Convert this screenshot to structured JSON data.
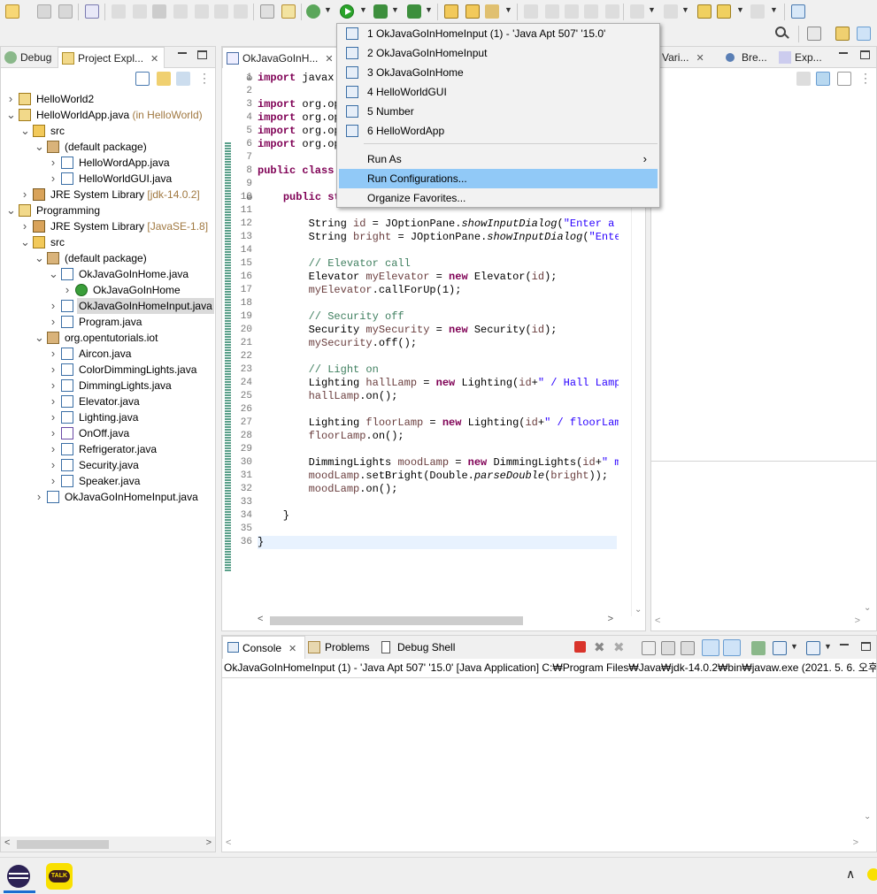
{
  "run_menu": {
    "items": [
      {
        "label": "1 OkJavaGoInHomeInput (1) - 'Java Apt 507' '15.0'"
      },
      {
        "label": "2 OkJavaGoInHomeInput"
      },
      {
        "label": "3 OkJavaGoInHome"
      },
      {
        "label": "4 HelloWorldGUI"
      },
      {
        "label": "5 Number"
      },
      {
        "label": "6 HelloWordApp"
      }
    ],
    "run_as": "Run As",
    "run_configurations": "Run Configurations...",
    "organize_favorites": "Organize Favorites..."
  },
  "left_tabs": {
    "debug": "Debug",
    "project_explorer": "Project Expl..."
  },
  "editor_tab": "OkJavaGoInH...",
  "right_tabs": {
    "variables": "Vari...",
    "breakpoints": "Bre...",
    "expressions": "Exp..."
  },
  "tree": [
    {
      "label": "HelloWorld2",
      "dec": "",
      "indent": 0,
      "arrow": ">",
      "icon": "project-icon"
    },
    {
      "label": "HelloWorldApp.java",
      "dec": " (in HelloWorld)",
      "indent": 0,
      "arrow": "v",
      "icon": "project-icon"
    },
    {
      "label": "src",
      "dec": "",
      "indent": 1,
      "arrow": "v",
      "icon": "src-folder-icon"
    },
    {
      "label": "(default package)",
      "dec": "",
      "indent": 2,
      "arrow": "v",
      "icon": "package-icon"
    },
    {
      "label": "HelloWordApp.java",
      "dec": "",
      "indent": 3,
      "arrow": ">",
      "icon": "java-file-icon"
    },
    {
      "label": "HelloWorldGUI.java",
      "dec": "",
      "indent": 3,
      "arrow": ">",
      "icon": "java-file-icon"
    },
    {
      "label": "JRE System Library",
      "dec": " [jdk-14.0.2]",
      "indent": 1,
      "arrow": ">",
      "icon": "library-icon"
    },
    {
      "label": "Programming",
      "dec": "",
      "indent": 0,
      "arrow": "v",
      "icon": "project-icon"
    },
    {
      "label": "JRE System Library",
      "dec": " [JavaSE-1.8]",
      "indent": 1,
      "arrow": ">",
      "icon": "library-icon"
    },
    {
      "label": "src",
      "dec": "",
      "indent": 1,
      "arrow": "v",
      "icon": "src-folder-icon"
    },
    {
      "label": "(default package)",
      "dec": "",
      "indent": 2,
      "arrow": "v",
      "icon": "package-icon"
    },
    {
      "label": "OkJavaGoInHome.java",
      "dec": "",
      "indent": 3,
      "arrow": "v",
      "icon": "java-file-icon"
    },
    {
      "label": "OkJavaGoInHome",
      "dec": "",
      "indent": 4,
      "arrow": ">",
      "icon": "class-icon"
    },
    {
      "label": "OkJavaGoInHomeInput.java",
      "dec": "",
      "indent": 3,
      "arrow": ">",
      "icon": "java-file-icon",
      "selected": true
    },
    {
      "label": "Program.java",
      "dec": "",
      "indent": 3,
      "arrow": ">",
      "icon": "java-file-icon"
    },
    {
      "label": "org.opentutorials.iot",
      "dec": "",
      "indent": 2,
      "arrow": "v",
      "icon": "package-icon"
    },
    {
      "label": "Aircon.java",
      "dec": "",
      "indent": 3,
      "arrow": ">",
      "icon": "java-file-icon"
    },
    {
      "label": "ColorDimmingLights.java",
      "dec": "",
      "indent": 3,
      "arrow": ">",
      "icon": "java-file-icon"
    },
    {
      "label": "DimmingLights.java",
      "dec": "",
      "indent": 3,
      "arrow": ">",
      "icon": "java-file-icon"
    },
    {
      "label": "Elevator.java",
      "dec": "",
      "indent": 3,
      "arrow": ">",
      "icon": "java-file-icon"
    },
    {
      "label": "Lighting.java",
      "dec": "",
      "indent": 3,
      "arrow": ">",
      "icon": "java-file-icon"
    },
    {
      "label": "OnOff.java",
      "dec": "",
      "indent": 3,
      "arrow": ">",
      "icon": "interface-file-icon"
    },
    {
      "label": "Refrigerator.java",
      "dec": "",
      "indent": 3,
      "arrow": ">",
      "icon": "java-file-icon"
    },
    {
      "label": "Security.java",
      "dec": "",
      "indent": 3,
      "arrow": ">",
      "icon": "java-file-icon"
    },
    {
      "label": "Speaker.java",
      "dec": "",
      "indent": 3,
      "arrow": ">",
      "icon": "java-file-icon"
    },
    {
      "label": "OkJavaGoInHomeInput.java",
      "dec": "",
      "indent": 2,
      "arrow": ">",
      "icon": "java-file-icon"
    }
  ],
  "code_lines": [
    {
      "n": "1",
      "html": "<span class='kw'>import</span> javax."
    },
    {
      "n": "2",
      "html": ""
    },
    {
      "n": "3",
      "html": "<span class='kw'>import</span> org.op"
    },
    {
      "n": "4",
      "html": "<span class='kw'>import</span> org.op"
    },
    {
      "n": "5",
      "html": "<span class='kw'>import</span> org.op"
    },
    {
      "n": "6",
      "html": "<span class='kw'>import</span> org.op"
    },
    {
      "n": "7",
      "html": ""
    },
    {
      "n": "8",
      "html": "<span class='kw'>public class</span>"
    },
    {
      "n": "9",
      "html": ""
    },
    {
      "n": "10",
      "html": "    <span class='kw'>public st</span>"
    },
    {
      "n": "11",
      "html": ""
    },
    {
      "n": "12",
      "html": "        String <span class='var'>id</span> = JOptionPane.<span class='it'>showInputDialog</span>(<span class='str'>\"Enter a I</span>"
    },
    {
      "n": "13",
      "html": "        String <span class='var'>bright</span> = JOptionPane.<span class='it'>showInputDialog</span>(<span class='str'>\"Enter</span>"
    },
    {
      "n": "14",
      "html": ""
    },
    {
      "n": "15",
      "html": "        <span class='cm'>// Elevator call</span>"
    },
    {
      "n": "16",
      "html": "        Elevator <span class='var'>myElevator</span> = <span class='kw'>new</span> Elevator(<span class='var'>id</span>);"
    },
    {
      "n": "17",
      "html": "        <span class='var'>myElevator</span>.callForUp(1);"
    },
    {
      "n": "18",
      "html": ""
    },
    {
      "n": "19",
      "html": "        <span class='cm'>// Security off</span>"
    },
    {
      "n": "20",
      "html": "        Security <span class='var'>mySecurity</span> = <span class='kw'>new</span> Security(<span class='var'>id</span>);"
    },
    {
      "n": "21",
      "html": "        <span class='var'>mySecurity</span>.off();"
    },
    {
      "n": "22",
      "html": ""
    },
    {
      "n": "23",
      "html": "        <span class='cm'>// Light on</span>"
    },
    {
      "n": "24",
      "html": "        Lighting <span class='var'>hallLamp</span> = <span class='kw'>new</span> Lighting(<span class='var'>id</span>+<span class='str'>\" / Hall Lamp\"</span>"
    },
    {
      "n": "25",
      "html": "        <span class='var'>hallLamp</span>.on();"
    },
    {
      "n": "26",
      "html": ""
    },
    {
      "n": "27",
      "html": "        Lighting <span class='var'>floorLamp</span> = <span class='kw'>new</span> Lighting(<span class='var'>id</span>+<span class='str'>\" / floorLamp</span>"
    },
    {
      "n": "28",
      "html": "        <span class='var'>floorLamp</span>.on();"
    },
    {
      "n": "29",
      "html": ""
    },
    {
      "n": "30",
      "html": "        DimmingLights <span class='var'>moodLamp</span> = <span class='kw'>new</span> DimmingLights(<span class='var'>id</span>+<span class='str'>\" mo</span>"
    },
    {
      "n": "31",
      "html": "        <span class='var'>moodLamp</span>.setBright(Double.<span class='it'>parseDouble</span>(<span class='var'>bright</span>));"
    },
    {
      "n": "32",
      "html": "        <span class='var'>moodLamp</span>.on();"
    },
    {
      "n": "33",
      "html": ""
    },
    {
      "n": "34",
      "html": "    }"
    },
    {
      "n": "35",
      "html": ""
    },
    {
      "n": "36",
      "html": "}"
    }
  ],
  "console": {
    "tabs": {
      "console": "Console",
      "problems": "Problems",
      "debug_shell": "Debug Shell"
    },
    "status_line": "OkJavaGoInHomeInput (1) - 'Java Apt 507' '15.0' [Java Application] C:₩Program Files₩Java₩jdk-14.0.2₩bin₩javaw.exe  (2021. 5. 6. 오후"
  },
  "taskbar": {
    "talk_label": "TALK"
  },
  "colors": {
    "selection": "#91c9f7",
    "keyword": "#7f0055",
    "string": "#2a00ff",
    "comment": "#3f7f5f"
  }
}
